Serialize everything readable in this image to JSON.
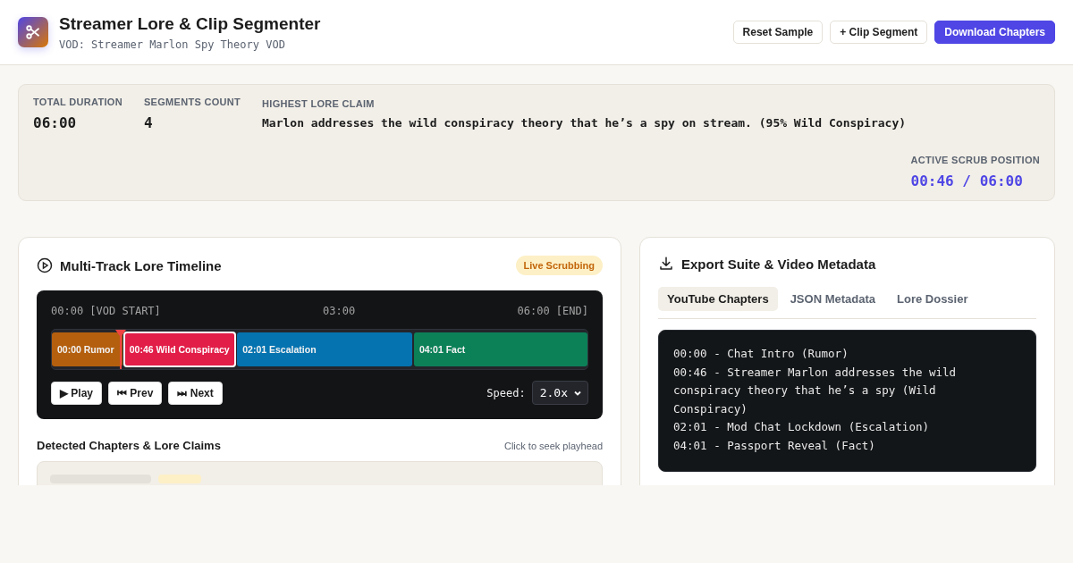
{
  "header": {
    "title": "Streamer Lore & Clip Segmenter",
    "subtitle": "VOD: Streamer Marlon Spy Theory VOD",
    "buttons": [
      {
        "label": "Reset Sample",
        "kind": "secondary"
      },
      {
        "label": "+ Clip Segment",
        "kind": "secondary"
      },
      {
        "label": "Download Chapters",
        "kind": "primary"
      }
    ]
  },
  "stats": [
    {
      "label": "TOTAL DURATION",
      "value": "06:00",
      "kind": "plain"
    },
    {
      "label": "SEGMENTS COUNT",
      "value": "4",
      "kind": "plain"
    },
    {
      "label": "HIGHEST LORE CLAIM",
      "value": "Marlon addresses the wild conspiracy theory that he’s a spy on stream. (95% Wild Conspiracy)",
      "kind": "claim"
    },
    {
      "label": "ACTIVE SCRUB POSITION",
      "value": "00:46 / 06:00",
      "kind": "accent"
    }
  ],
  "timeline": {
    "title": "Multi-Track Lore Timeline",
    "badge": "Live Scrubbing",
    "ticks": [
      "00:00 [VOD START]",
      "03:00",
      "06:00 [END]"
    ],
    "playhead": {
      "level": 0.128
    },
    "segments": [
      {
        "label": "00:00 Rumor",
        "color": "#b45f0e",
        "selected": false
      },
      {
        "label": "00:46 Wild Conspiracy",
        "color": "#e11d48",
        "selected": true
      },
      {
        "label": "02:01 Escalation",
        "color": "#0573b0",
        "selected": false
      },
      {
        "label": "04:01 Fact",
        "color": "#0c8158",
        "selected": false
      }
    ],
    "controls": [
      "▶ Play",
      "⏮ Prev",
      "⏭ Next"
    ],
    "speed_label": "Speed:",
    "speed": "2.0x",
    "chapters_title": "Detected Chapters & Lore Claims",
    "chapters_hint": "Click to seek playhead"
  },
  "export": {
    "title": "Export Suite & Video Metadata",
    "tabs": [
      {
        "label": "YouTube Chapters",
        "selected": true
      },
      {
        "label": "JSON Metadata",
        "selected": false
      },
      {
        "label": "Lore Dossier",
        "selected": false
      }
    ],
    "lines": [
      "00:00 - Chat Intro (Rumor)",
      "00:46 - Streamer Marlon addresses the wild conspiracy theory that he’s a spy (Wild Conspiracy)",
      "02:01 - Mod Chat Lockdown (Escalation)",
      "04:01 - Passport Reveal (Fact)"
    ]
  }
}
